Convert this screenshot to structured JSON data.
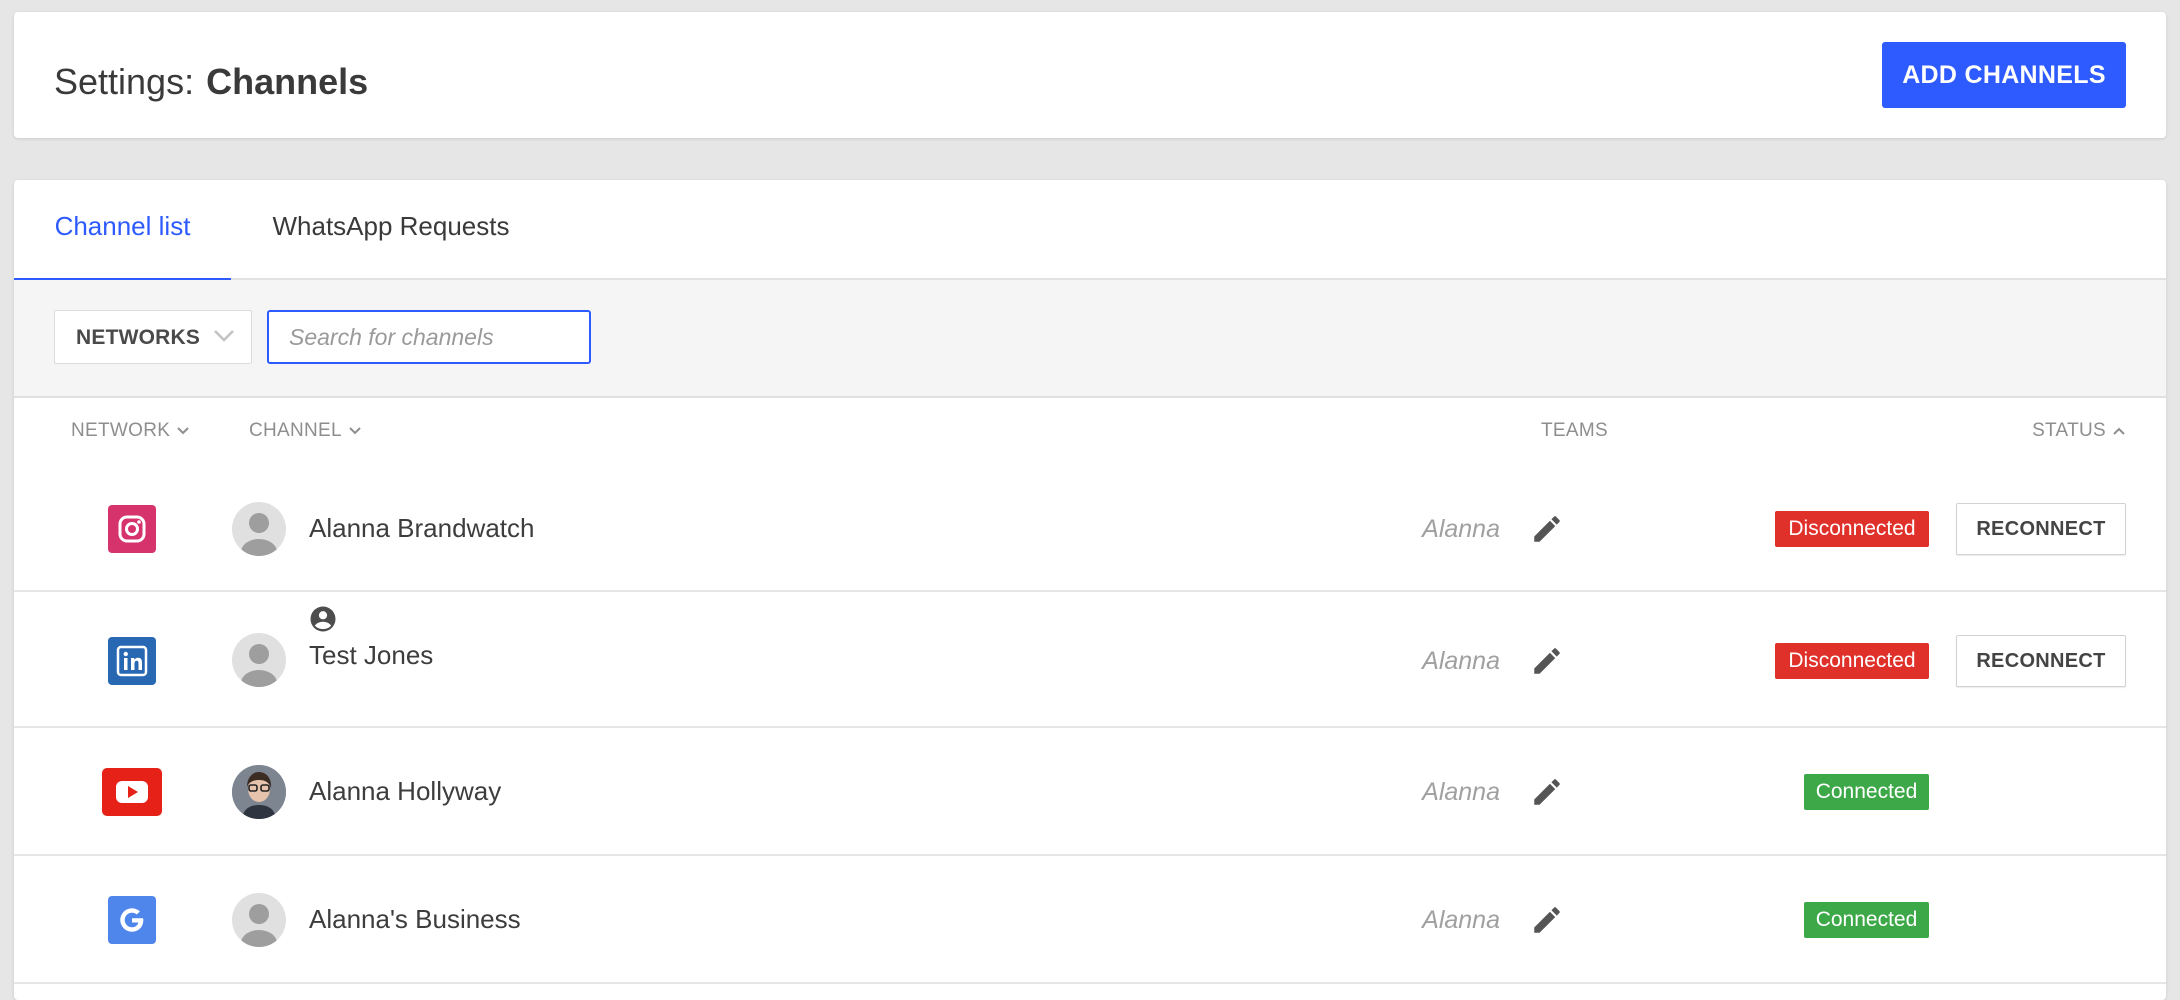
{
  "header": {
    "title_prefix": "Settings:",
    "title_name": "Channels",
    "add_button": "ADD CHANNELS"
  },
  "tabs": [
    {
      "label": "Channel list",
      "active": true
    },
    {
      "label": "WhatsApp Requests",
      "active": false
    }
  ],
  "filters": {
    "networks_label": "NETWORKS",
    "search_placeholder": "Search for channels",
    "search_value": ""
  },
  "columns": {
    "network": "NETWORK",
    "channel": "CHANNEL",
    "teams": "TEAMS",
    "status": "STATUS"
  },
  "rows": [
    {
      "network": "instagram",
      "network_icon": "instagram-icon",
      "channel": "Alanna Brandwatch",
      "team": "Alanna",
      "status": "Disconnected",
      "action": "RECONNECT"
    },
    {
      "network": "linkedin",
      "network_icon": "linkedin-icon",
      "channel": "Test Jones",
      "team": "Alanna",
      "status": "Disconnected",
      "action": "RECONNECT"
    },
    {
      "network": "youtube",
      "network_icon": "youtube-icon",
      "channel": "Alanna Hollyway",
      "team": "Alanna",
      "status": "Connected",
      "action": ""
    },
    {
      "network": "google",
      "network_icon": "google-icon",
      "channel": "Alanna's Business",
      "team": "Alanna",
      "status": "Connected",
      "action": ""
    }
  ],
  "colors": {
    "accent": "#2e5bff",
    "disconnected": "#e0302a",
    "connected": "#3da847",
    "instagram": "#d6336c",
    "linkedin": "#2867b2",
    "youtube": "#e62117",
    "google": "#4f86ec"
  }
}
